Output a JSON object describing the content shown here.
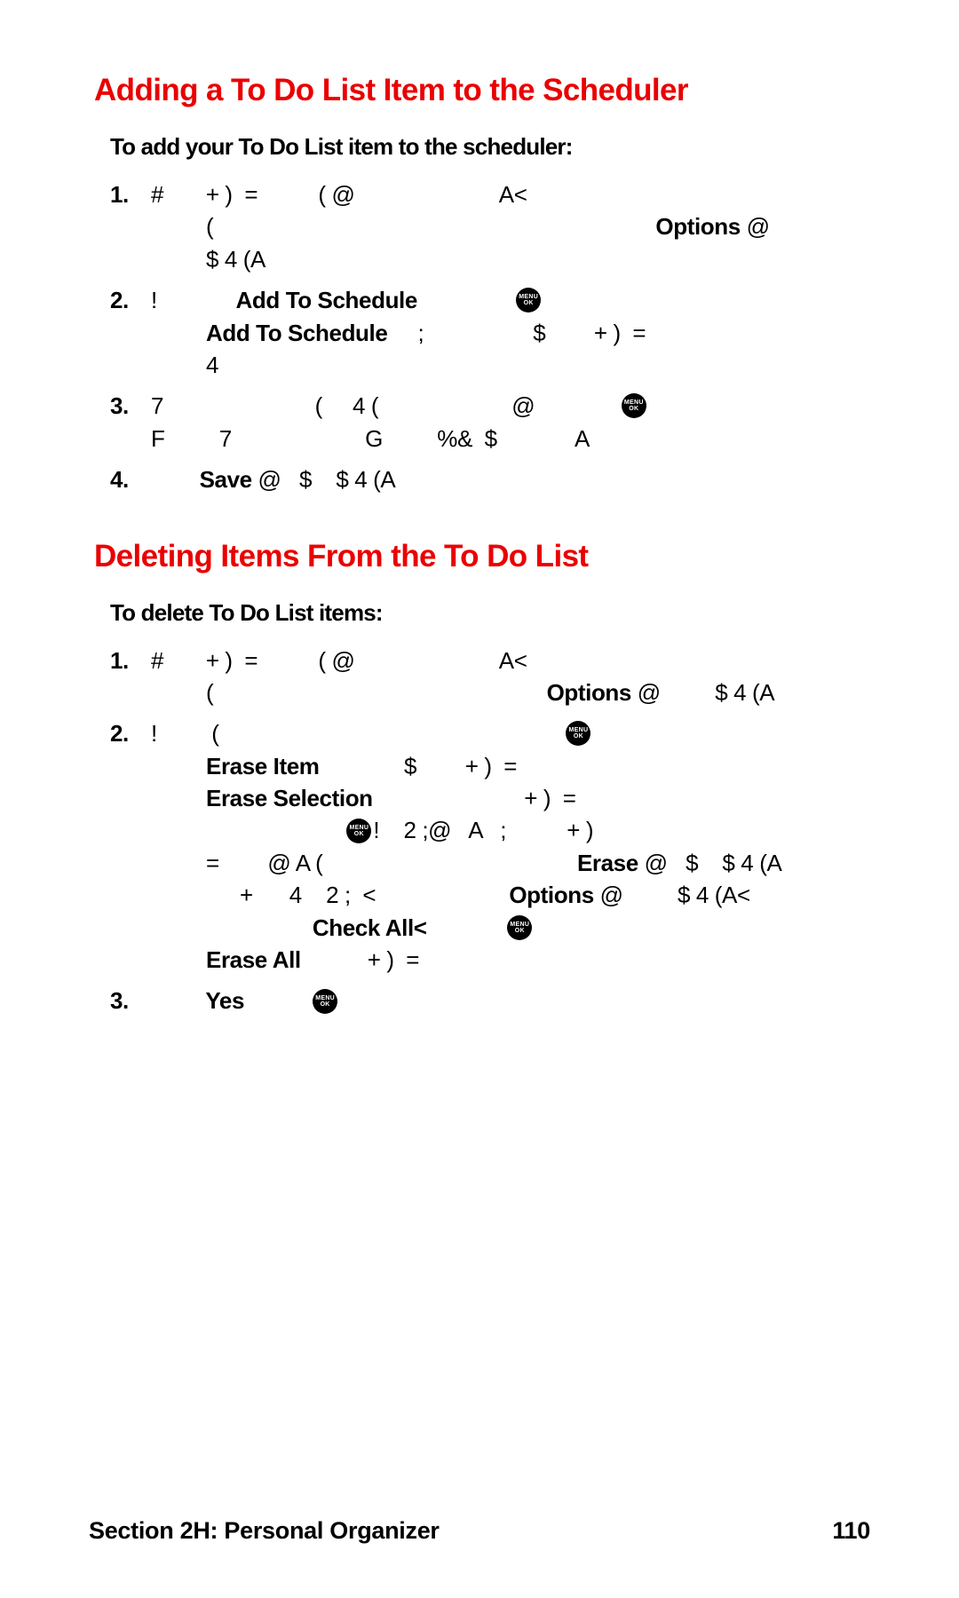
{
  "section1": {
    "title": "Adding a To Do List Item to the Scheduler",
    "subtitle": "To add your To Do List item to the scheduler:",
    "step1": {
      "num": "1.",
      "l1a": "#       + )  =          ( @                        A<",
      "l2a": "(                                                                         ",
      "l2b": "Options",
      "l2c": " @",
      "l3": "$ 4 (A"
    },
    "step2": {
      "num": "2.",
      "l1a": "!             ",
      "l1b": "Add To Schedule",
      "l1c": "                ",
      "l2a": "Add To Schedule",
      "l2b": "     ;                  $        + )  =",
      "l3": "4"
    },
    "step3": {
      "num": "3.",
      "l1a": "7                         (     4 (                      @              ",
      "l2": "F         7                      G         %&  $             A"
    },
    "step4": {
      "num": "4.",
      "l1a": "        ",
      "l1b": "Save",
      "l1c": " @   $    $ 4 (A"
    }
  },
  "section2": {
    "title": "Deleting Items From the To Do List",
    "subtitle": "To delete To Do List items:",
    "step1": {
      "num": "1.",
      "l1": "#       + )  =          ( @                        A<",
      "l2a": "(                                                       ",
      "l2b": "Options",
      "l2c": " @         $ 4 (A"
    },
    "step2": {
      "num": "2.",
      "l1a": "!         (                                                         ",
      "l2a": "Erase Item",
      "l2b": "              $        + )  =",
      "l3a": "Erase Selection",
      "l3b": "                         + )  =",
      "l4a": "                                ",
      "l4b": "!    2 ;@   A   ;          + )",
      "l5a": "=        @ A (                                          ",
      "l5b": "Erase",
      "l5c": " @   $    $ 4 (A",
      "l6a": "+      4    2 ;  <                      ",
      "l6b": "Options",
      "l6c": " @         $ 4 (A<",
      "l7a": "Check All<",
      "l7b": "             ",
      "l8a": "Erase All",
      "l8b": "           + )  ="
    },
    "step3": {
      "num": "3.",
      "l1a": "         ",
      "l1b": "Yes",
      "l1c": "           "
    }
  },
  "footer": {
    "left": "Section 2H: Personal Organizer",
    "right": "110"
  },
  "icon": {
    "menu": "MENU",
    "ok": "OK"
  }
}
